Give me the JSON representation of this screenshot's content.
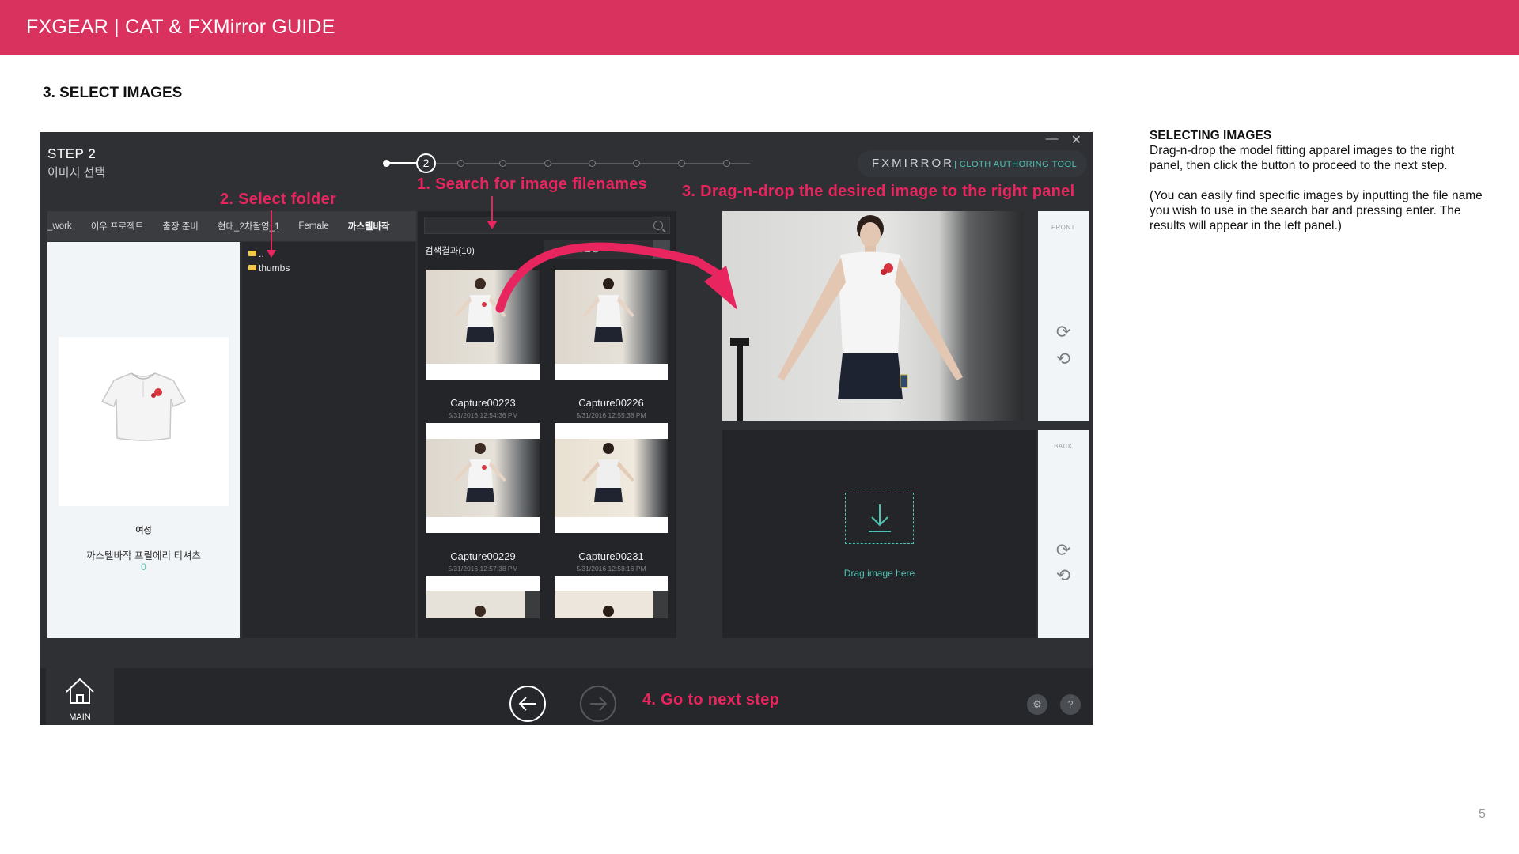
{
  "slide": {
    "header_title": "FXGEAR | CAT & FXMirror GUIDE",
    "section_title": "3. SELECT IMAGES",
    "page_number": "5",
    "accent_color": "#d9325e"
  },
  "description": {
    "heading": "SELECTING IMAGES",
    "paragraph1": "Drag-n-drop the model fitting apparel images to the right panel, then click the button to proceed to the next step.",
    "paragraph2": "(You can easily find specific images by inputting the file name you wish to use in the search bar and pressing enter. The results will appear in the left panel.)"
  },
  "app": {
    "step_label": "STEP 2",
    "step_sub": "이미지 선택",
    "current_step": "2",
    "brand": "FXMIRROR",
    "brand_sub": "| CLOTH AUTHORING TOOL",
    "window_minimize": "—",
    "window_close": "✕",
    "tabs": [
      "_work",
      "이우 프로젝트",
      "출장 준비",
      "현대_2차촬영_1",
      "Female",
      "까스텔바작"
    ],
    "card": {
      "gender": "여성",
      "name": "까스텔바작 프릴에리 티셔츠",
      "count": "0"
    },
    "folders": [
      "..",
      "thumbs"
    ],
    "search": {
      "placeholder": "",
      "results_label": "검색결과(10)",
      "sort_value": "파일명"
    },
    "thumbnails": [
      {
        "name": "Capture00223",
        "date": "5/31/2016 12:54:36 PM"
      },
      {
        "name": "Capture00226",
        "date": "5/31/2016 12:55:38 PM"
      },
      {
        "name": "Capture00229",
        "date": "5/31/2016 12:57:38 PM"
      },
      {
        "name": "Capture00231",
        "date": "5/31/2016 12:58:16 PM"
      }
    ],
    "front_label": "FRONT",
    "back_label": "BACK",
    "drop_label": "Drag image here",
    "main_label": "MAIN",
    "help_label": "?"
  },
  "annotations": {
    "search": "1. Search for image filenames",
    "folder": "2. Select folder",
    "drag": "3. Drag-n-drop the desired image to the right panel",
    "next": "4. Go to next step",
    "color": "#e8255f"
  }
}
